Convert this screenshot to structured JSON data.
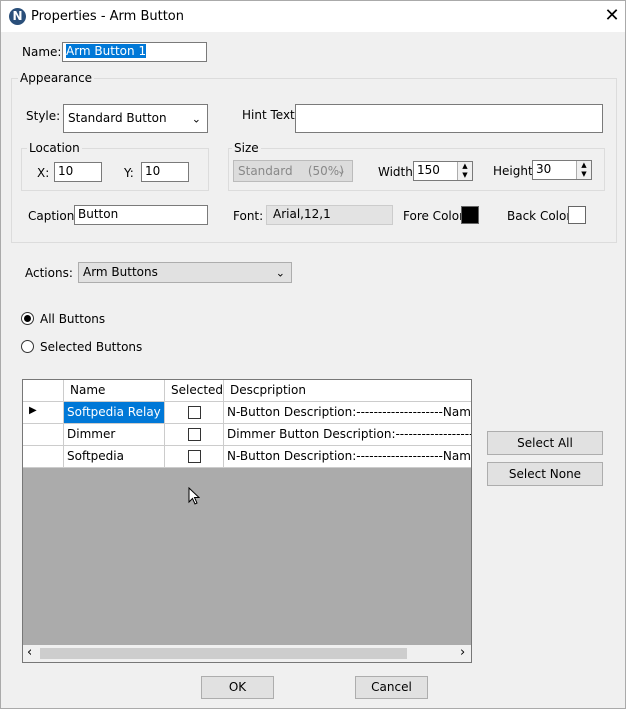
{
  "window": {
    "title": "Properties - Arm Button",
    "app_icon_letter": "N"
  },
  "name": {
    "label": "Name:",
    "value": "Arm Button 1"
  },
  "appearance": {
    "label": "Appearance",
    "style_label": "Style:",
    "style_value": "Standard Button",
    "hint_label": "Hint Text:",
    "hint_value": "",
    "location": {
      "label": "Location",
      "x_label": "X:",
      "x_value": "10",
      "y_label": "Y:",
      "y_value": "10"
    },
    "size": {
      "label": "Size",
      "preset_value": "Standard    (50%)",
      "width_label": "Width:",
      "width_value": "150",
      "height_label": "Height:",
      "height_value": "30"
    },
    "caption_label": "Caption:",
    "caption_value": "Button",
    "font_label": "Font:",
    "font_value": "Arial,12,1",
    "fore_color_label": "Fore Color:",
    "fore_color": "#000000",
    "back_color_label": "Back Color:",
    "back_color": "#ffffff"
  },
  "actions": {
    "label": "Actions:",
    "value": "Arm Buttons"
  },
  "radios": {
    "all": "All Buttons",
    "selected": "Selected Buttons",
    "checked": "all"
  },
  "grid": {
    "columns": [
      "Name",
      "Selected",
      "Descpription"
    ],
    "rows": [
      {
        "name": "Softpedia Relay ...",
        "desc": "N-Button Description:--------------------Name : Softpedia"
      },
      {
        "name": "Dimmer",
        "desc": "Dimmer Button Description:--------------------Name: Dimmer"
      },
      {
        "name": "Softpedia",
        "desc": "N-Button Description:--------------------Name : Softpedia"
      }
    ],
    "scroll_left": "‹",
    "scroll_right": "›"
  },
  "buttons": {
    "select_all": "Select All",
    "select_none": "Select None",
    "ok": "OK",
    "cancel": "Cancel"
  },
  "colors": {
    "selection": "#0078d7",
    "grid_empty": "#ababab"
  }
}
